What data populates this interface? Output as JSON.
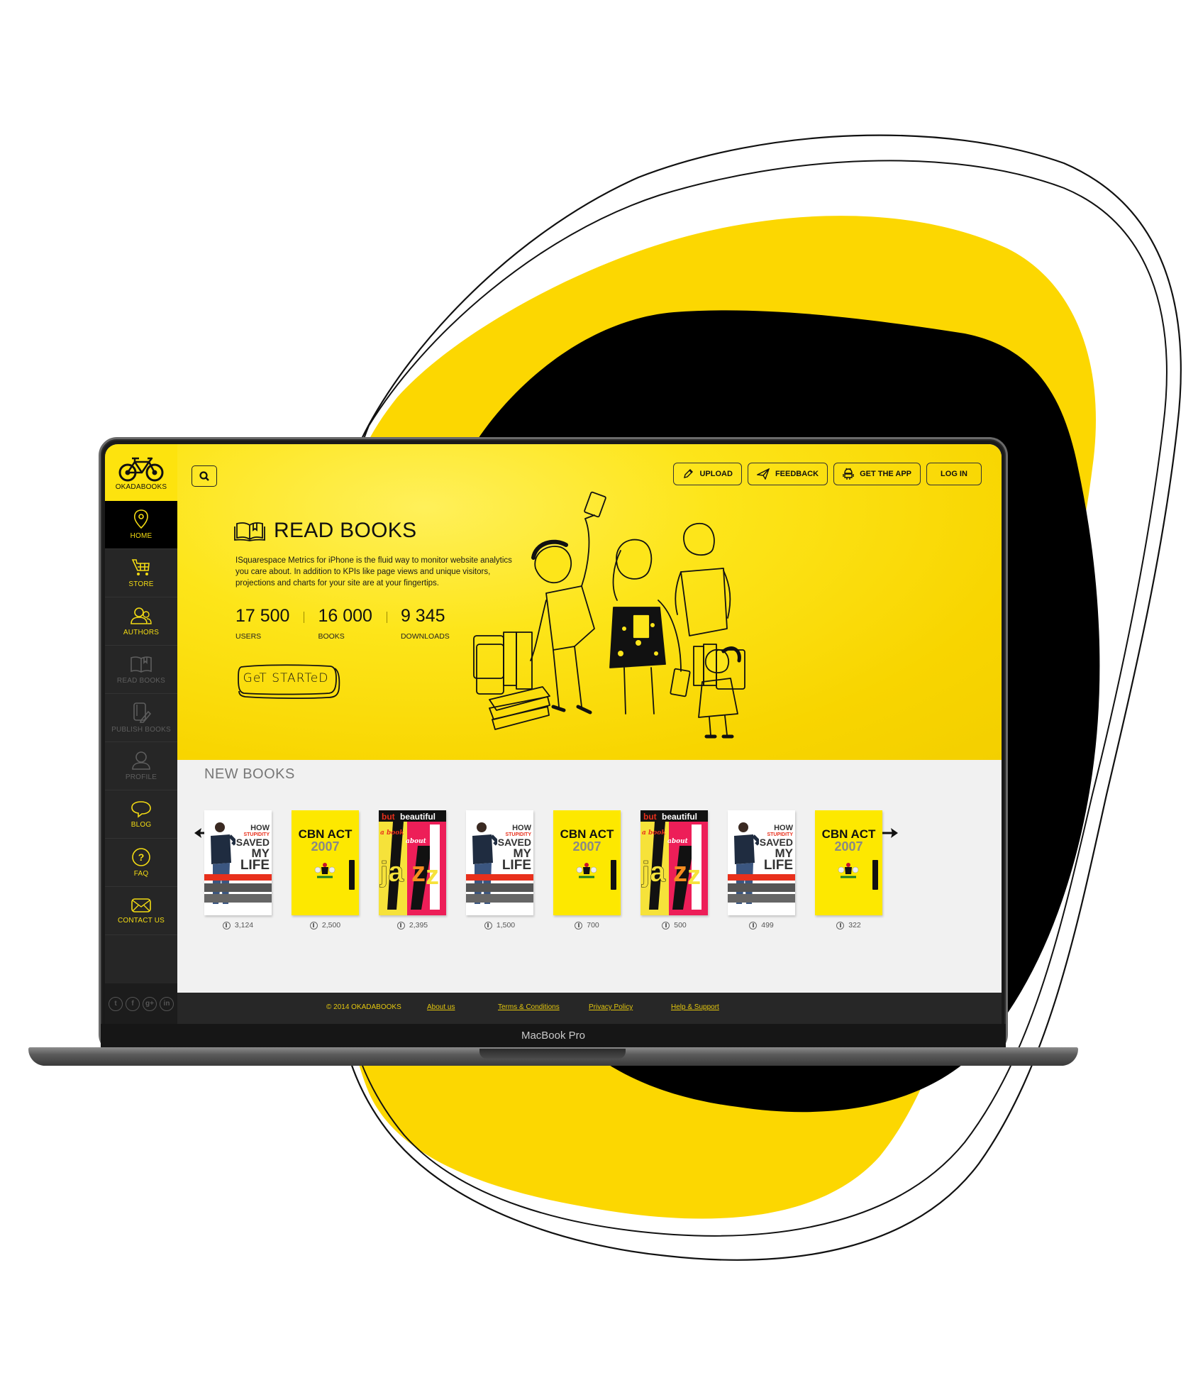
{
  "device": {
    "label": "MacBook Pro"
  },
  "brand": {
    "name": "OKADABOOKS",
    "accent": "#fde30e",
    "dark": "#262626",
    "nav_active_text": "#f4dc13",
    "nav_inactive_text": "#5e5e5e"
  },
  "sidebar": {
    "items": [
      {
        "label": "HOME",
        "icon": "map-pin-icon",
        "active": true,
        "enabled": true
      },
      {
        "label": "STORE",
        "icon": "cart-icon",
        "active": false,
        "enabled": true
      },
      {
        "label": "AUTHORS",
        "icon": "users-icon",
        "active": false,
        "enabled": true
      },
      {
        "label": "READ BOOKS",
        "icon": "open-book-icon",
        "active": false,
        "enabled": false
      },
      {
        "label": "PUBLISH BOOKS",
        "icon": "publish-icon",
        "active": false,
        "enabled": false
      },
      {
        "label": "PROFILE",
        "icon": "user-icon",
        "active": false,
        "enabled": false
      },
      {
        "label": "BLOG",
        "icon": "speech-bubble-icon",
        "active": false,
        "enabled": true
      },
      {
        "label": "FAQ",
        "icon": "question-icon",
        "active": false,
        "enabled": true
      },
      {
        "label": "CONTACT US",
        "icon": "envelope-icon",
        "active": false,
        "enabled": true
      }
    ],
    "social": [
      {
        "name": "twitter",
        "glyph": "t"
      },
      {
        "name": "facebook",
        "glyph": "f"
      },
      {
        "name": "google-plus",
        "glyph": "g+"
      },
      {
        "name": "linkedin",
        "glyph": "in"
      }
    ]
  },
  "header": {
    "search_icon": "search-icon",
    "buttons": [
      {
        "label": "UPLOAD",
        "icon": "pencil-icon"
      },
      {
        "label": "FEEDBACK",
        "icon": "paper-plane-icon"
      },
      {
        "label": "GET THE APP",
        "icon": "android-icon"
      },
      {
        "label": "LOG IN",
        "icon": ""
      }
    ]
  },
  "hero": {
    "title": "READ BOOKS",
    "description": "ISquarespace Metrics for iPhone is the fluid way to monitor website analytics you care about. In addition to KPIs like page views and unique  visitors, projections and charts for your site are at your fingertips.",
    "stats": [
      {
        "value": "17 500",
        "label": "USERS"
      },
      {
        "value": "16 000",
        "label": "BOOKS"
      },
      {
        "value": "9 345",
        "label": "DOWNLOADS"
      }
    ],
    "cta": "GeT STARTeD"
  },
  "new_books": {
    "title": "NEW BOOKS",
    "items": [
      {
        "cover": "how",
        "title": "How Stupidity Saved My Life",
        "downloads": "3,124"
      },
      {
        "cover": "cbn",
        "title": "CBN Act 2007",
        "downloads": "2,500"
      },
      {
        "cover": "jazz",
        "title": "But Beautiful: A Book About Jazz",
        "downloads": "2,395"
      },
      {
        "cover": "how",
        "title": "How Stupidity Saved My Life",
        "downloads": "1,500"
      },
      {
        "cover": "cbn",
        "title": "CBN Act 2007",
        "downloads": "700"
      },
      {
        "cover": "jazz",
        "title": "But Beautiful: A Book About Jazz",
        "downloads": "500"
      },
      {
        "cover": "how",
        "title": "How Stupidity Saved My Life",
        "downloads": "499"
      },
      {
        "cover": "cbn",
        "title": "CBN Act 2007",
        "downloads": "322"
      }
    ],
    "cover_text": {
      "how": {
        "l1": "HOW",
        "l2": "STUPIDITY",
        "l3": "SAVED",
        "l4": "MY",
        "l5": "LIFE"
      },
      "cbn": {
        "l1": "CBN ACT",
        "l2": "2007"
      },
      "jazz": {
        "l1": "but",
        "l2": "beautiful",
        "l3": "a book",
        "l4": "about",
        "l5": "jazz"
      }
    }
  },
  "footer": {
    "copyright": "© 2014 OKADABOOKS",
    "links": [
      "About us",
      "Terms & Conditions",
      "Privacy Policy",
      "Help & Support"
    ]
  }
}
